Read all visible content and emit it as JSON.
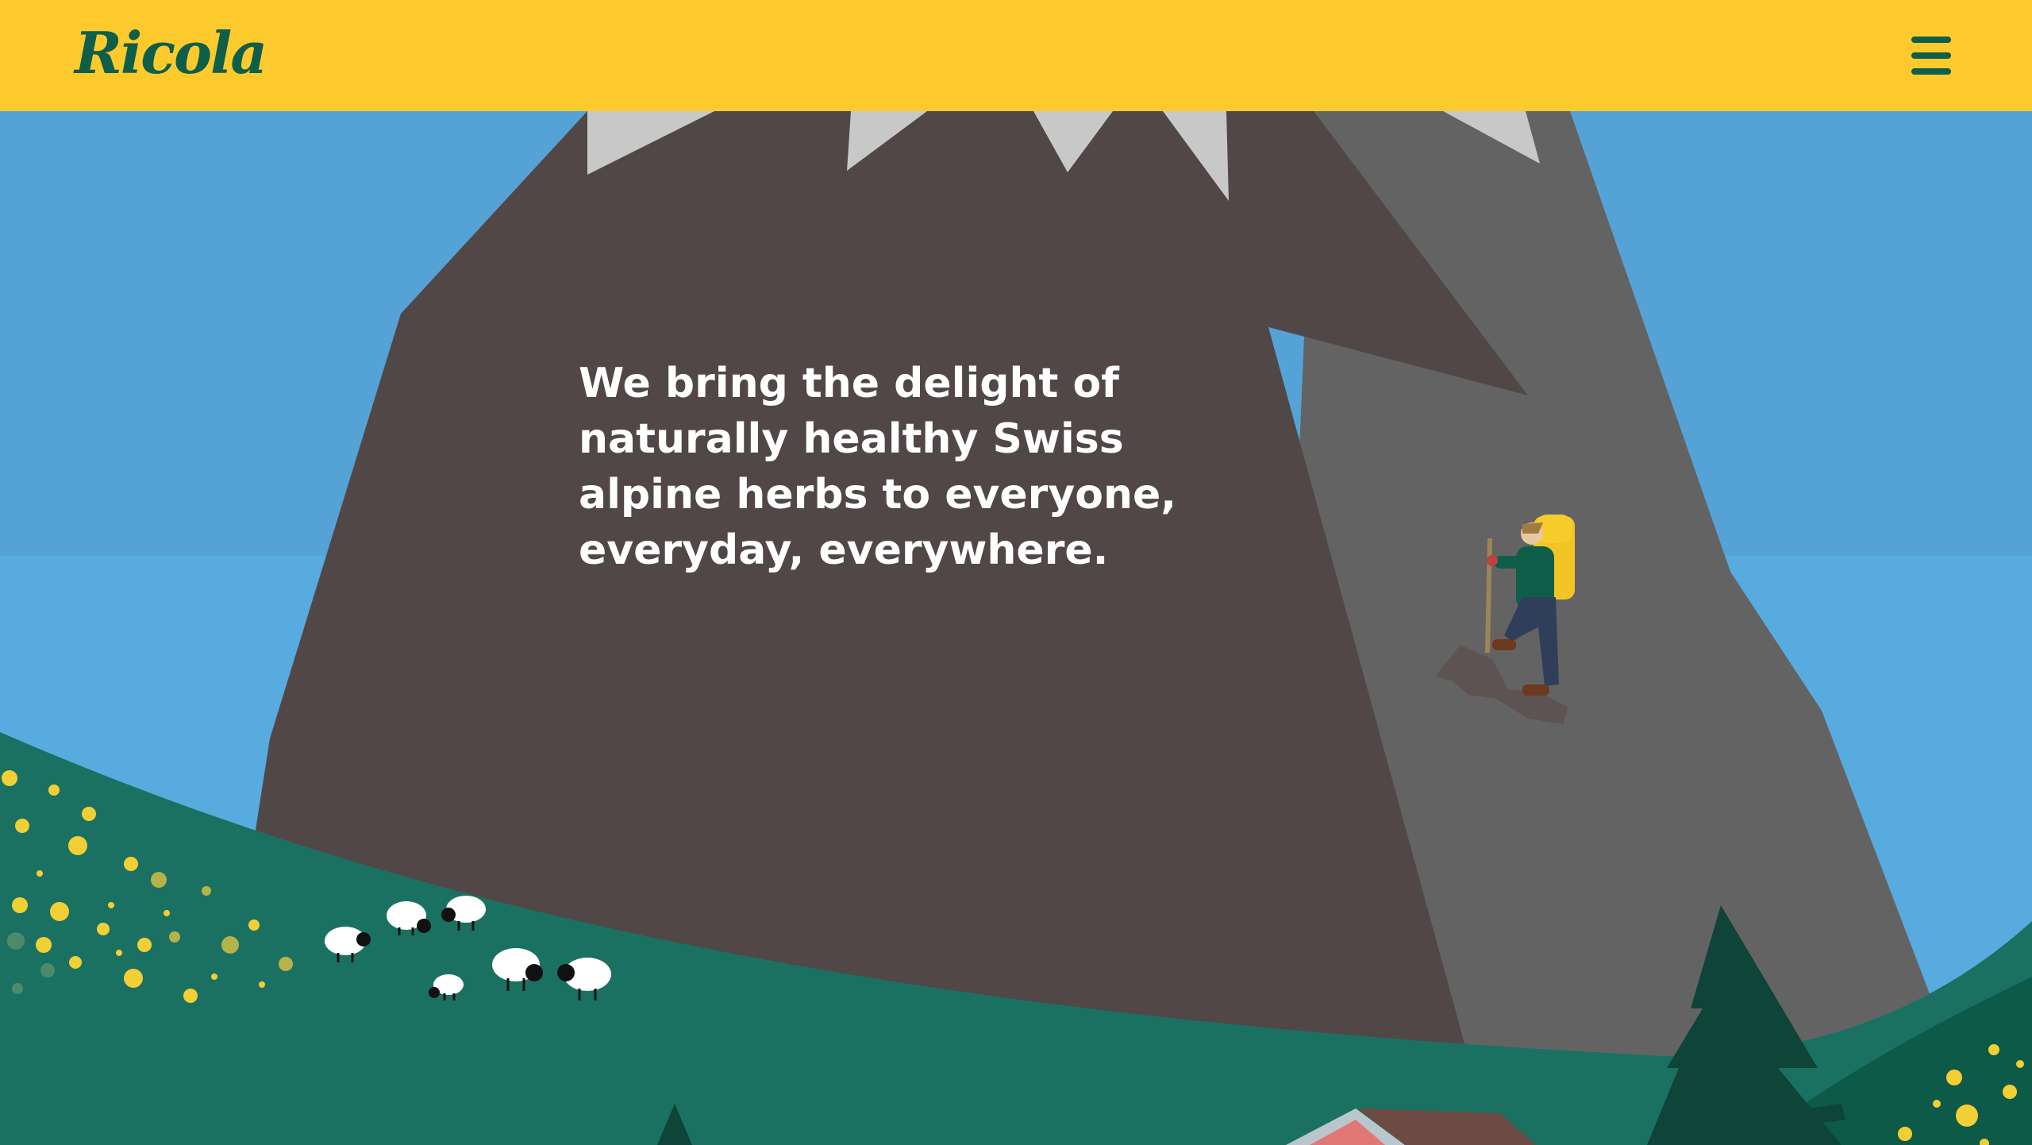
{
  "brand": {
    "logo_text": "Ricola"
  },
  "header": {
    "menu_icon": "hamburger-menu-icon"
  },
  "hero": {
    "tagline": "We bring the delight of naturally healthy Swiss alpine herbs to everyone, everyday, everywhere."
  },
  "colors": {
    "header_bg": "#fdca2e",
    "brand_green": "#0f5e49",
    "sky": "#55a3d6",
    "mountain_dark": "#514747",
    "mountain_light": "#646363",
    "meadow": "#1b7161"
  }
}
